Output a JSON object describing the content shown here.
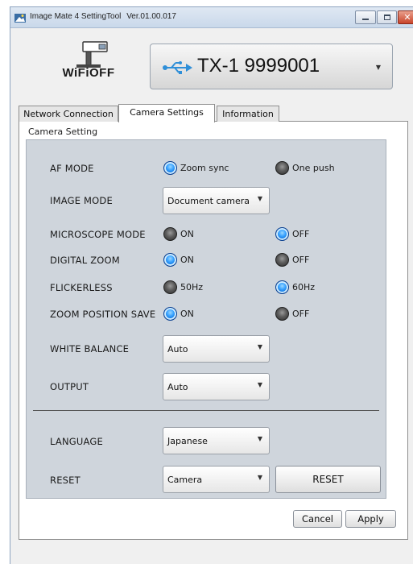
{
  "window": {
    "title": "Image Mate 4 SettingTool",
    "version": "Ver.01.00.017"
  },
  "header": {
    "logo_text": "WiFiOFF",
    "device_name": "TX-1 9999001"
  },
  "tabs": [
    {
      "label": "Network Connection",
      "active": false
    },
    {
      "label": "Camera Settings",
      "active": true
    },
    {
      "label": "Information",
      "active": false
    }
  ],
  "group": {
    "label": "Camera Setting"
  },
  "settings": {
    "af_mode": {
      "label": "AF MODE",
      "option1": "Zoom sync",
      "option2": "One push",
      "selected": "Zoom sync"
    },
    "image_mode": {
      "label": "IMAGE MODE",
      "value": "Document camera"
    },
    "microscope_mode": {
      "label": "MICROSCOPE MODE",
      "option1": "ON",
      "option2": "OFF",
      "selected": "OFF"
    },
    "digital_zoom": {
      "label": "DIGITAL ZOOM",
      "option1": "ON",
      "option2": "OFF",
      "selected": "ON"
    },
    "flickerless": {
      "label": "FLICKERLESS",
      "option1": "50Hz",
      "option2": "60Hz",
      "selected": "60Hz"
    },
    "zoom_position_save": {
      "label": "ZOOM POSITION SAVE",
      "option1": "ON",
      "option2": "OFF",
      "selected": "ON"
    },
    "white_balance": {
      "label": "WHITE BALANCE",
      "value": "Auto"
    },
    "output": {
      "label": "OUTPUT",
      "value": "Auto"
    },
    "language": {
      "label": "LANGUAGE",
      "value": "Japanese"
    },
    "reset": {
      "label": "RESET",
      "value": "Camera",
      "button": "RESET"
    }
  },
  "footer": {
    "cancel_label": "Cancel",
    "apply_label": "Apply"
  },
  "colors": {
    "radio_on": "#1b7fe8",
    "radio_off": "#4a4a4a",
    "panel_bg": "#cfd5dc"
  }
}
